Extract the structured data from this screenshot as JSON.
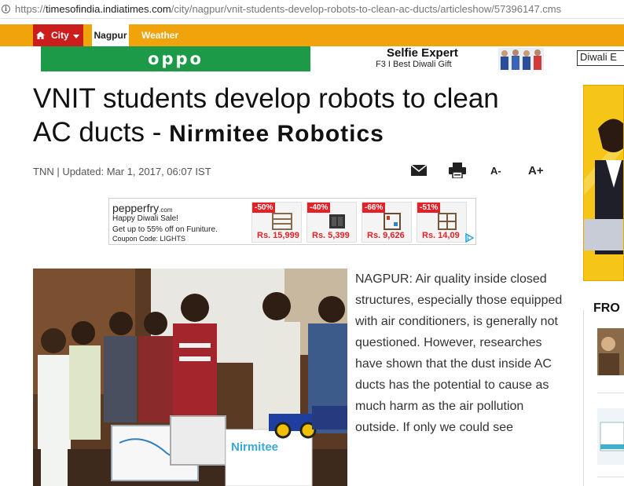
{
  "browser": {
    "url_scheme": "https://",
    "url_host": "timesofindia.indiatimes.com",
    "url_path": "/city/nagpur/vnit-students-develop-robots-to-clean-ac-ducts/articleshow/57396147.cms"
  },
  "nav": {
    "city_label": "City",
    "nagpur_label": "Nagpur",
    "weather_label": "Weather"
  },
  "top_ad": {
    "brand": "oppo",
    "headline": "Selfie Expert",
    "subline": "F3 I Best Diwali Gift",
    "diwali_text": "Diwali E"
  },
  "article": {
    "headline": "VNIT students develop robots to clean AC ducts -",
    "headline_suffix": "Nirmitee Robotics",
    "byline": "TNN | Updated: Mar 1, 2017, 06:07 IST",
    "font_decrease": "A-",
    "font_increase": "A+",
    "body_start": "NAGPUR: Air quality inside closed structures, especially those equipped with air conditioners, is generally not questioned. However, researches have shown that the dust inside AC ducts has the potential to cause as much harm as the air pollution outside. If only we could see",
    "photo_box_label": "Nirmitee"
  },
  "pepperfry_ad": {
    "logo": "pepperfry",
    "logo_suffix": ".com",
    "line1": "Happy Diwali Sale!",
    "line2": "Get up to 55% off on Funiture.",
    "line3": "Coupon Code: LIGHTS",
    "products": [
      {
        "discount": "-50%",
        "price": "Rs. 15,999"
      },
      {
        "discount": "-40%",
        "price": "Rs. 5,399"
      },
      {
        "discount": "-66%",
        "price": "Rs. 9,626"
      },
      {
        "discount": "-51%",
        "price": "Rs. 14,09"
      }
    ]
  },
  "sidebar": {
    "section_heading": "FRO"
  },
  "colors": {
    "nav_orange": "#f0a30a",
    "nav_red": "#cc1d1d",
    "oppo_green": "#1d9a47",
    "discount_red": "#e32227"
  }
}
